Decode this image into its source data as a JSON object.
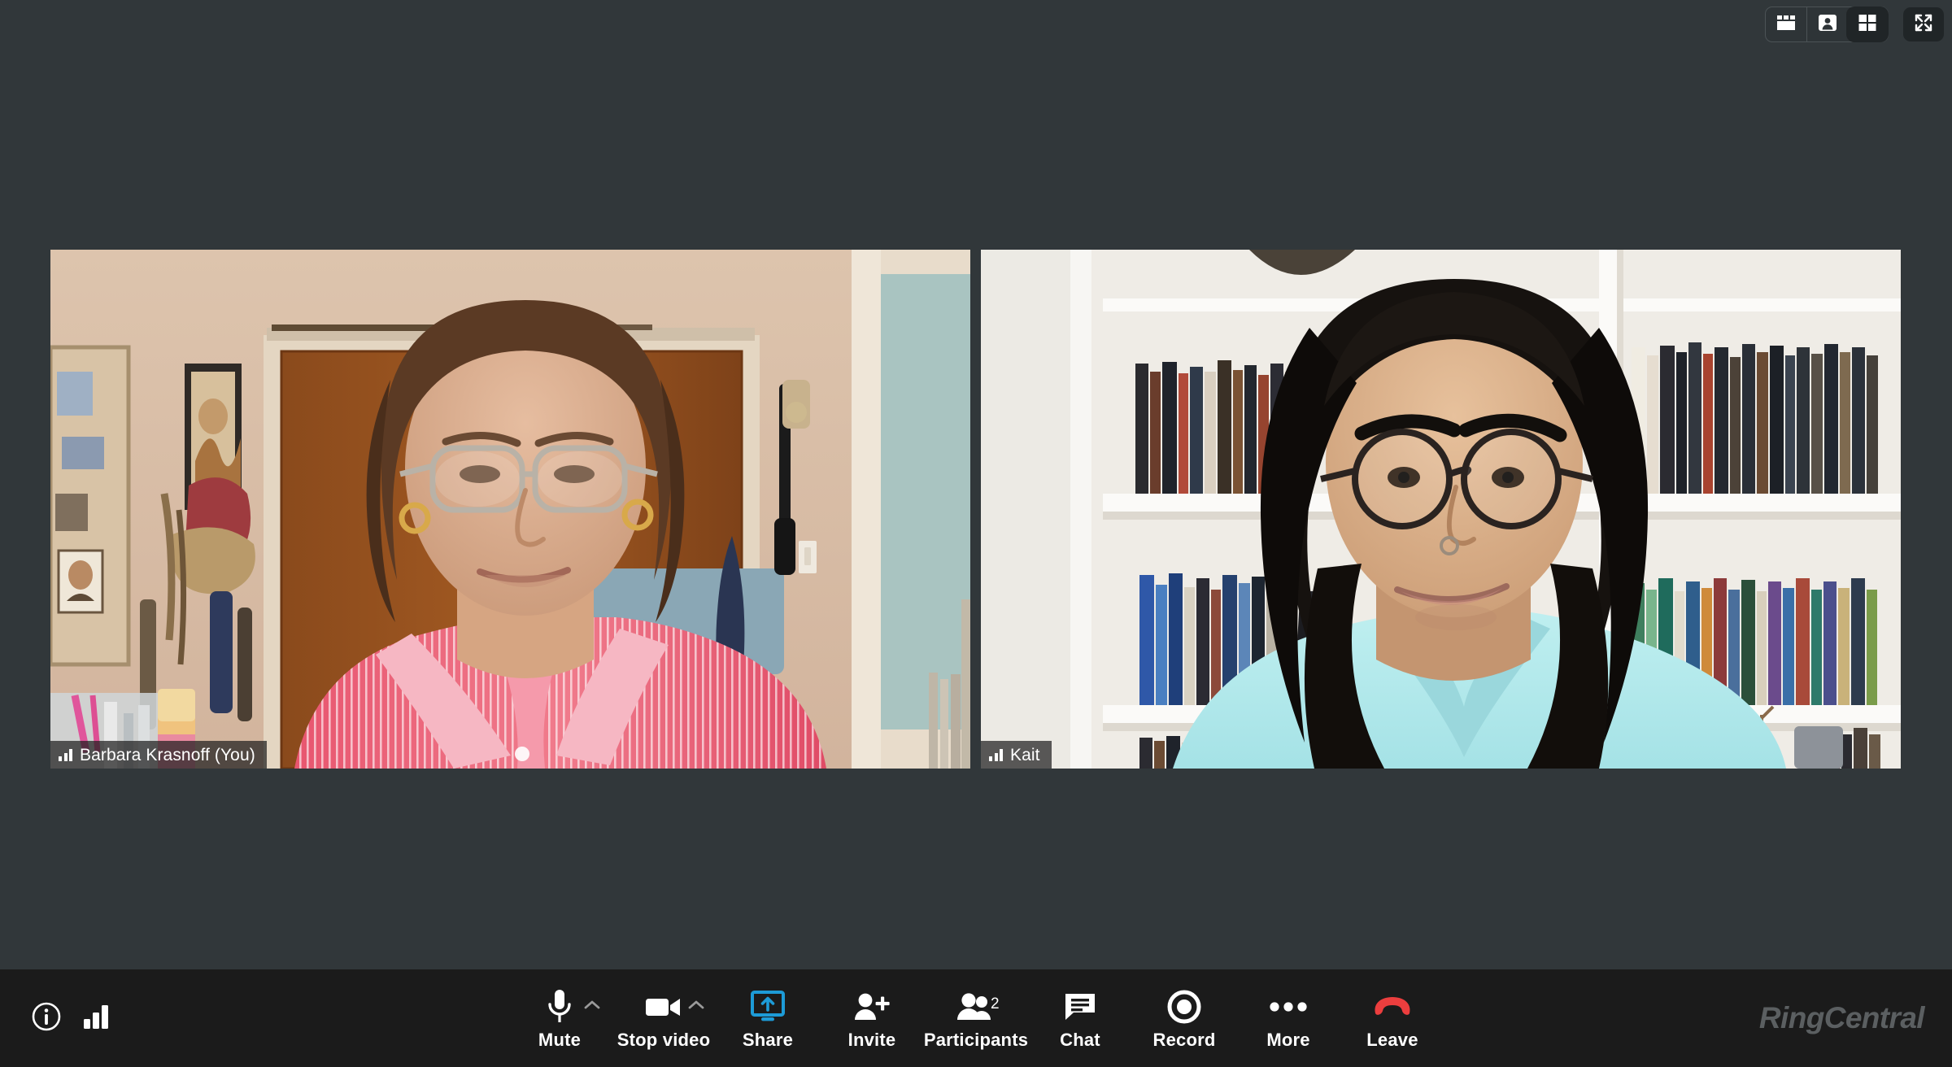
{
  "app": {
    "brand": "RingCentral",
    "background_color": "#31373a",
    "toolbar_color": "#1b1b1b",
    "accent_color": "#1d9bd7",
    "leave_color": "#eb3b3b"
  },
  "layout_controls": {
    "buttons": [
      {
        "name": "filmstrip-layout",
        "icon": "filmstrip-layout-icon",
        "active": false
      },
      {
        "name": "speaker-layout",
        "icon": "speaker-view-icon",
        "active": false
      },
      {
        "name": "grid-layout",
        "icon": "grid-layout-icon",
        "active": true
      }
    ],
    "fullscreen": {
      "name": "fullscreen",
      "icon": "fullscreen-icon"
    }
  },
  "participants": [
    {
      "name": "Barbara Krasnoff (You)",
      "signal_icon": "signal-bars-icon",
      "video_on": true
    },
    {
      "name": "Kait",
      "signal_icon": "signal-bars-icon",
      "video_on": true
    }
  ],
  "toolbar": {
    "left": [
      {
        "name": "meeting-info",
        "icon": "info-circle-icon"
      },
      {
        "name": "connection-quality",
        "icon": "signal-bars-icon"
      }
    ],
    "items": [
      {
        "label": "Mute",
        "icon": "microphone-icon",
        "has_chevron": true,
        "active": false
      },
      {
        "label": "Stop video",
        "icon": "video-camera-icon",
        "has_chevron": true,
        "active": false
      },
      {
        "label": "Share",
        "icon": "share-screen-icon",
        "has_chevron": false,
        "active": true
      },
      {
        "label": "Invite",
        "icon": "person-plus-icon",
        "has_chevron": false,
        "active": false
      },
      {
        "label": "Participants",
        "icon": "people-icon",
        "has_chevron": false,
        "active": false,
        "badge": "2"
      },
      {
        "label": "Chat",
        "icon": "chat-bubble-icon",
        "has_chevron": false,
        "active": false
      },
      {
        "label": "Record",
        "icon": "record-ring-icon",
        "has_chevron": false,
        "active": false
      },
      {
        "label": "More",
        "icon": "ellipsis-icon",
        "has_chevron": false,
        "active": false
      },
      {
        "label": "Leave",
        "icon": "hangup-phone-icon",
        "has_chevron": false,
        "active": false,
        "danger": true
      }
    ]
  }
}
